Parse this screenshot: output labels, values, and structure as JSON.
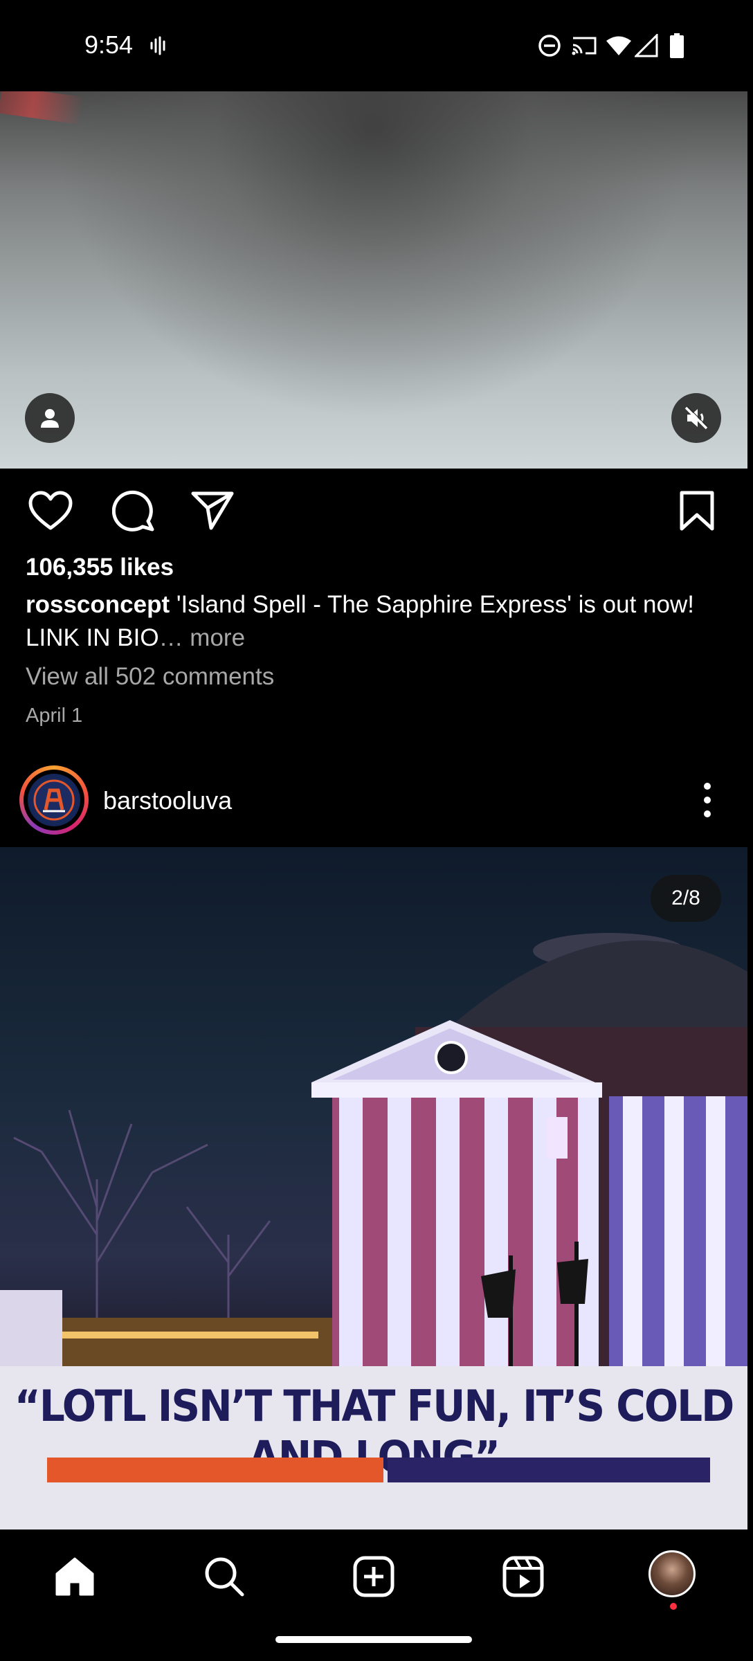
{
  "status_bar": {
    "time": "9:54",
    "icons": [
      "voicemail-wave-icon",
      "do-not-disturb-icon",
      "cast-icon",
      "wifi-icon",
      "cell-signal-icon",
      "battery-icon"
    ]
  },
  "post1": {
    "likes": "106,355 likes",
    "username": "rossconcept",
    "caption": " 'Island Spell - The Sapphire Express' is out now! LINK IN BIO",
    "more": "… more",
    "view_comments": "View all 502 comments",
    "date": "April 1"
  },
  "post2": {
    "username": "barstooluva",
    "counter": "2/8",
    "headline": "“LOTL ISN’T THAT FUN, IT’S COLD AND LONG”"
  },
  "colors": {
    "background": "#000000",
    "secondary_text": "#a8a8a8",
    "banner_orange": "#e4572a",
    "banner_navy": "#2a2466",
    "notification_dot": "#ff3040"
  }
}
